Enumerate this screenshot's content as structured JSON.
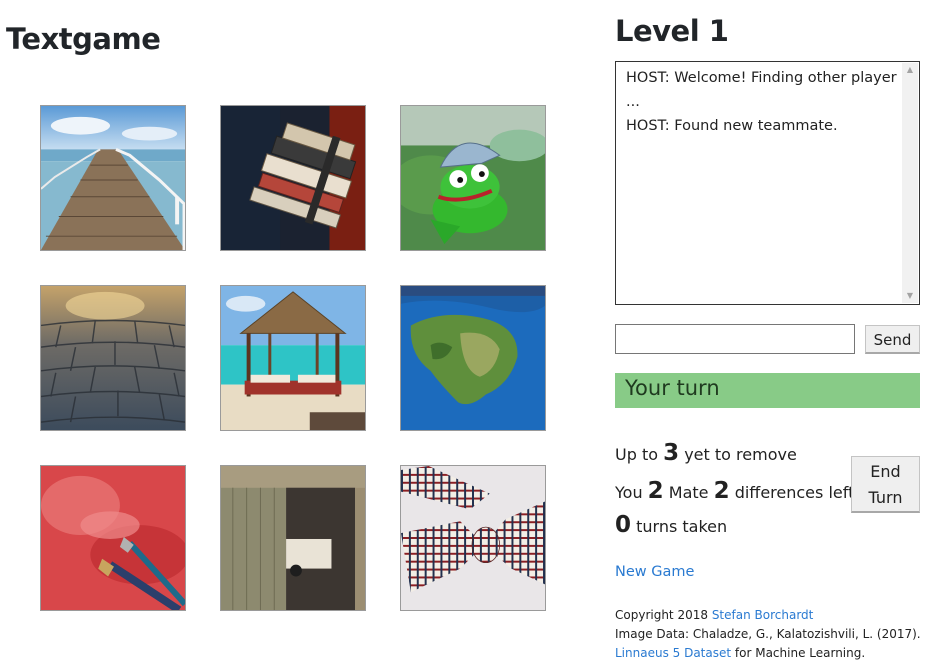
{
  "app_title": "Textgame",
  "level": "Level 1",
  "images": [
    {
      "name": "pier-image"
    },
    {
      "name": "books-image"
    },
    {
      "name": "kermit-image"
    },
    {
      "name": "cobblestone-image"
    },
    {
      "name": "gazebo-image"
    },
    {
      "name": "globe-image"
    },
    {
      "name": "paintbrush-image"
    },
    {
      "name": "garage-image"
    },
    {
      "name": "bowtie-image"
    }
  ],
  "chat": {
    "messages": [
      "HOST: Welcome! Finding other player\n...",
      "HOST: Found new teammate."
    ],
    "input_value": "",
    "send_label": "Send"
  },
  "turn_status": "Your turn",
  "status_color": "#88cb87",
  "stats": {
    "remove_count": "3",
    "remove_prefix": "Up to ",
    "remove_suffix": " yet to remove",
    "you_label": "You ",
    "you_count": "2",
    "mate_label": " Mate ",
    "mate_count": "2",
    "diff_suffix": " differences left",
    "turns_count": "0",
    "turns_suffix": " turns taken"
  },
  "end_turn_label_1": "End",
  "end_turn_label_2": "Turn",
  "new_game_label": "New Game",
  "footer": {
    "copyright_prefix": "Copyright 2018 ",
    "author_link": "Stefan Borchardt",
    "image_data": "Image Data: Chaladze, G., Kalatozishvili, L. (2017).",
    "dataset_link": "Linnaeus 5 Dataset",
    "dataset_suffix": " for Machine Learning."
  },
  "link_color": "#2a7ad1"
}
